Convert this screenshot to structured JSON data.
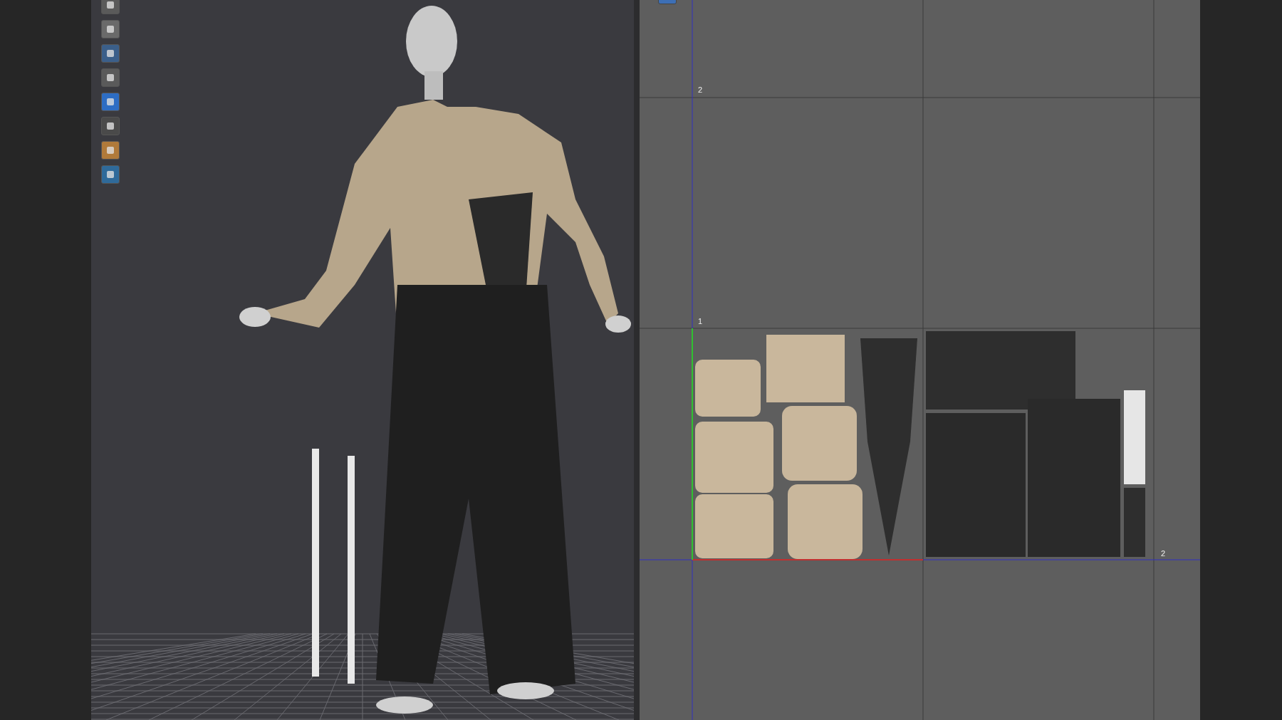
{
  "pattern_window": {
    "grid_labels": [
      "2",
      "1",
      "2"
    ]
  }
}
